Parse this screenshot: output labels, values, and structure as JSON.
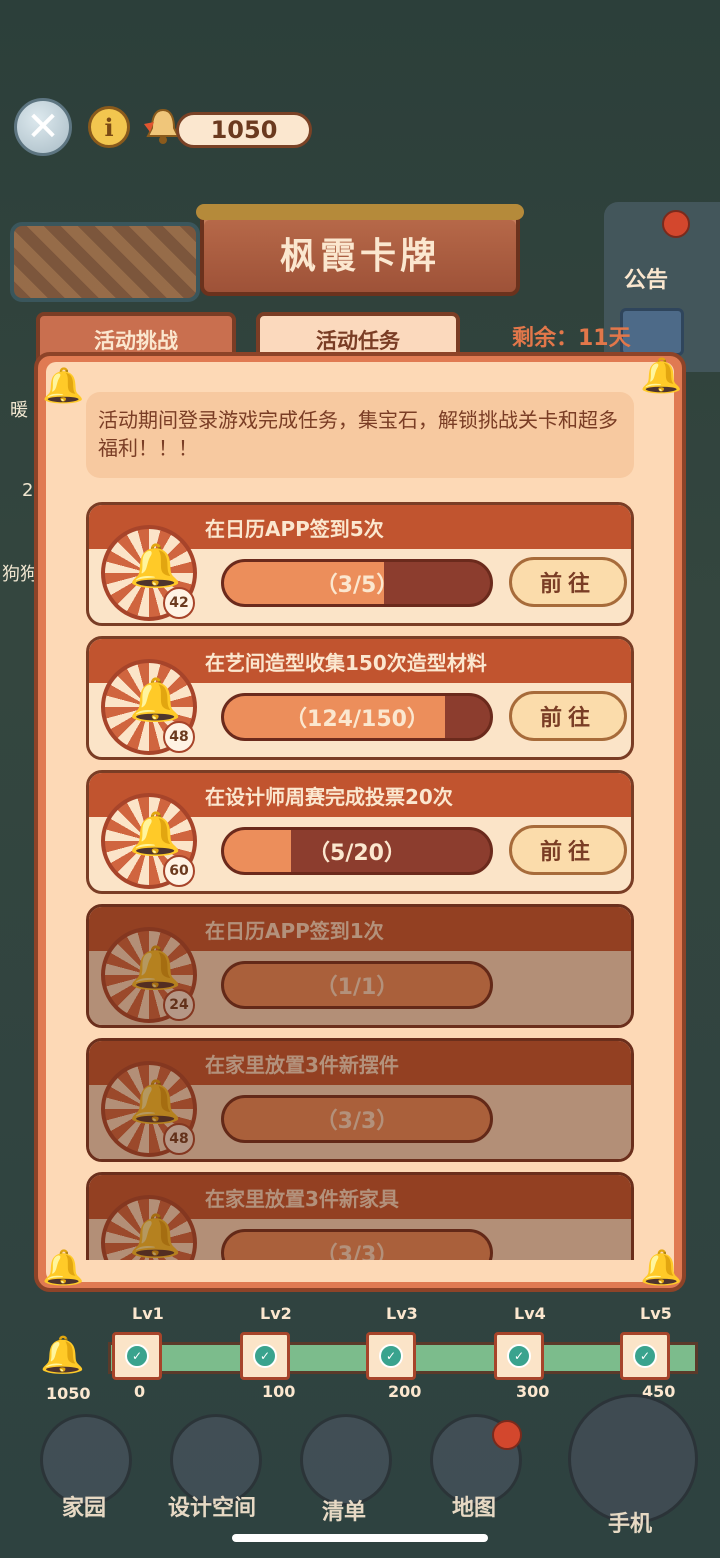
{
  "topbar": {
    "coins": "1050",
    "info_glyph": "i"
  },
  "side": {
    "left_text_1": "暖",
    "left_text_2": "2",
    "left_text_3": "狗狗",
    "notice_label": "公告"
  },
  "title": "枫霞卡牌",
  "tabs": [
    {
      "label": "活动挑战",
      "active": false
    },
    {
      "label": "活动任务",
      "active": true
    }
  ],
  "remaining": "剩余：11天",
  "intro": "活动期间登录游戏完成任务，集宝石，解锁挑战关卡和超多福利！！！",
  "tasks": [
    {
      "title": "在日历APP签到5次",
      "progress_text": "（3/5）",
      "progress": 0.6,
      "reward": "42",
      "button": "前往",
      "done": false
    },
    {
      "title": "在艺间造型收集150次造型材料",
      "progress_text": "（124/150）",
      "progress": 0.83,
      "reward": "48",
      "button": "前往",
      "done": false
    },
    {
      "title": "在设计师周赛完成投票20次",
      "progress_text": "（5/20）",
      "progress": 0.25,
      "reward": "60",
      "button": "前往",
      "done": false
    },
    {
      "title": "在日历APP签到1次",
      "progress_text": "（1/1）",
      "progress": 1,
      "reward": "24",
      "done": true
    },
    {
      "title": "在家里放置3件新摆件",
      "progress_text": "（3/3）",
      "progress": 1,
      "reward": "48",
      "done": true
    },
    {
      "title": "在家里放置3件新家具",
      "progress_text": "（3/3）",
      "progress": 1,
      "reward": "",
      "done": true
    }
  ],
  "track": {
    "current": "1050",
    "levels": [
      {
        "label": "Lv1",
        "value": "0"
      },
      {
        "label": "Lv2",
        "value": "100"
      },
      {
        "label": "Lv3",
        "value": "200"
      },
      {
        "label": "Lv4",
        "value": "300"
      },
      {
        "label": "Lv5",
        "value": "450"
      }
    ]
  },
  "nav": [
    {
      "label": "家园"
    },
    {
      "label": "设计空间"
    },
    {
      "label": "清单"
    },
    {
      "label": "地图"
    },
    {
      "label": "手机"
    }
  ],
  "colors": {
    "accent": "#c1542f",
    "panel": "#fdd9b6",
    "track": "#7cbc8c"
  }
}
